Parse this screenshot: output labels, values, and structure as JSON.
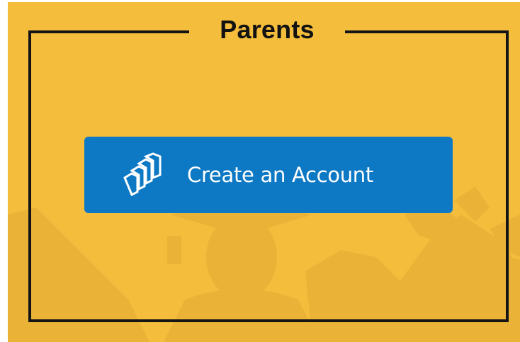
{
  "colors": {
    "background": "#f4bd3c",
    "frame": "#141414",
    "button": "#0d78c3",
    "button_text": "#ffffff"
  },
  "section": {
    "title": "Parents"
  },
  "cta": {
    "label": "Create an Account",
    "icon": "stacked-chevrons-logo-icon"
  }
}
